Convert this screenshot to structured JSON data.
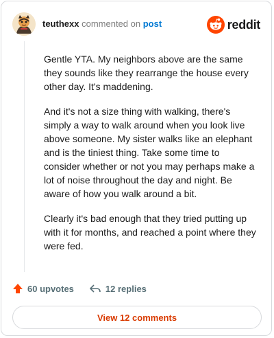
{
  "header": {
    "username": "teuthexx",
    "commented": "commented on",
    "post_link": "post",
    "brand": "reddit",
    "avatar_icon": "snoo-avatar-icon",
    "brand_icon": "reddit-logo-icon"
  },
  "comment": {
    "paragraphs": [
      "Gentle YTA. My neighbors above are the same they sounds like they rearrange the house every other day. It's maddening.",
      "And it's not a size thing with walking, there's simply a way to walk around when you look live above someone. My sister walks like an elephant and is the tiniest thing. Take some time to consider whether or not you may perhaps make a lot of noise throughout the day and night. Be aware of how you walk around a bit.",
      "Clearly it's bad enough that they tried putting up with it for months, and reached a point where they were fed."
    ]
  },
  "actions": {
    "upvotes": "60 upvotes",
    "replies": "12 replies",
    "upvote_icon": "upvote-arrow-icon",
    "reply_icon": "reply-arrow-icon"
  },
  "footer": {
    "view_comments": "View 12 comments"
  },
  "colors": {
    "accent": "#ff4500",
    "link": "#0079d3",
    "button_text": "#d93a00",
    "muted": "#576f76"
  }
}
